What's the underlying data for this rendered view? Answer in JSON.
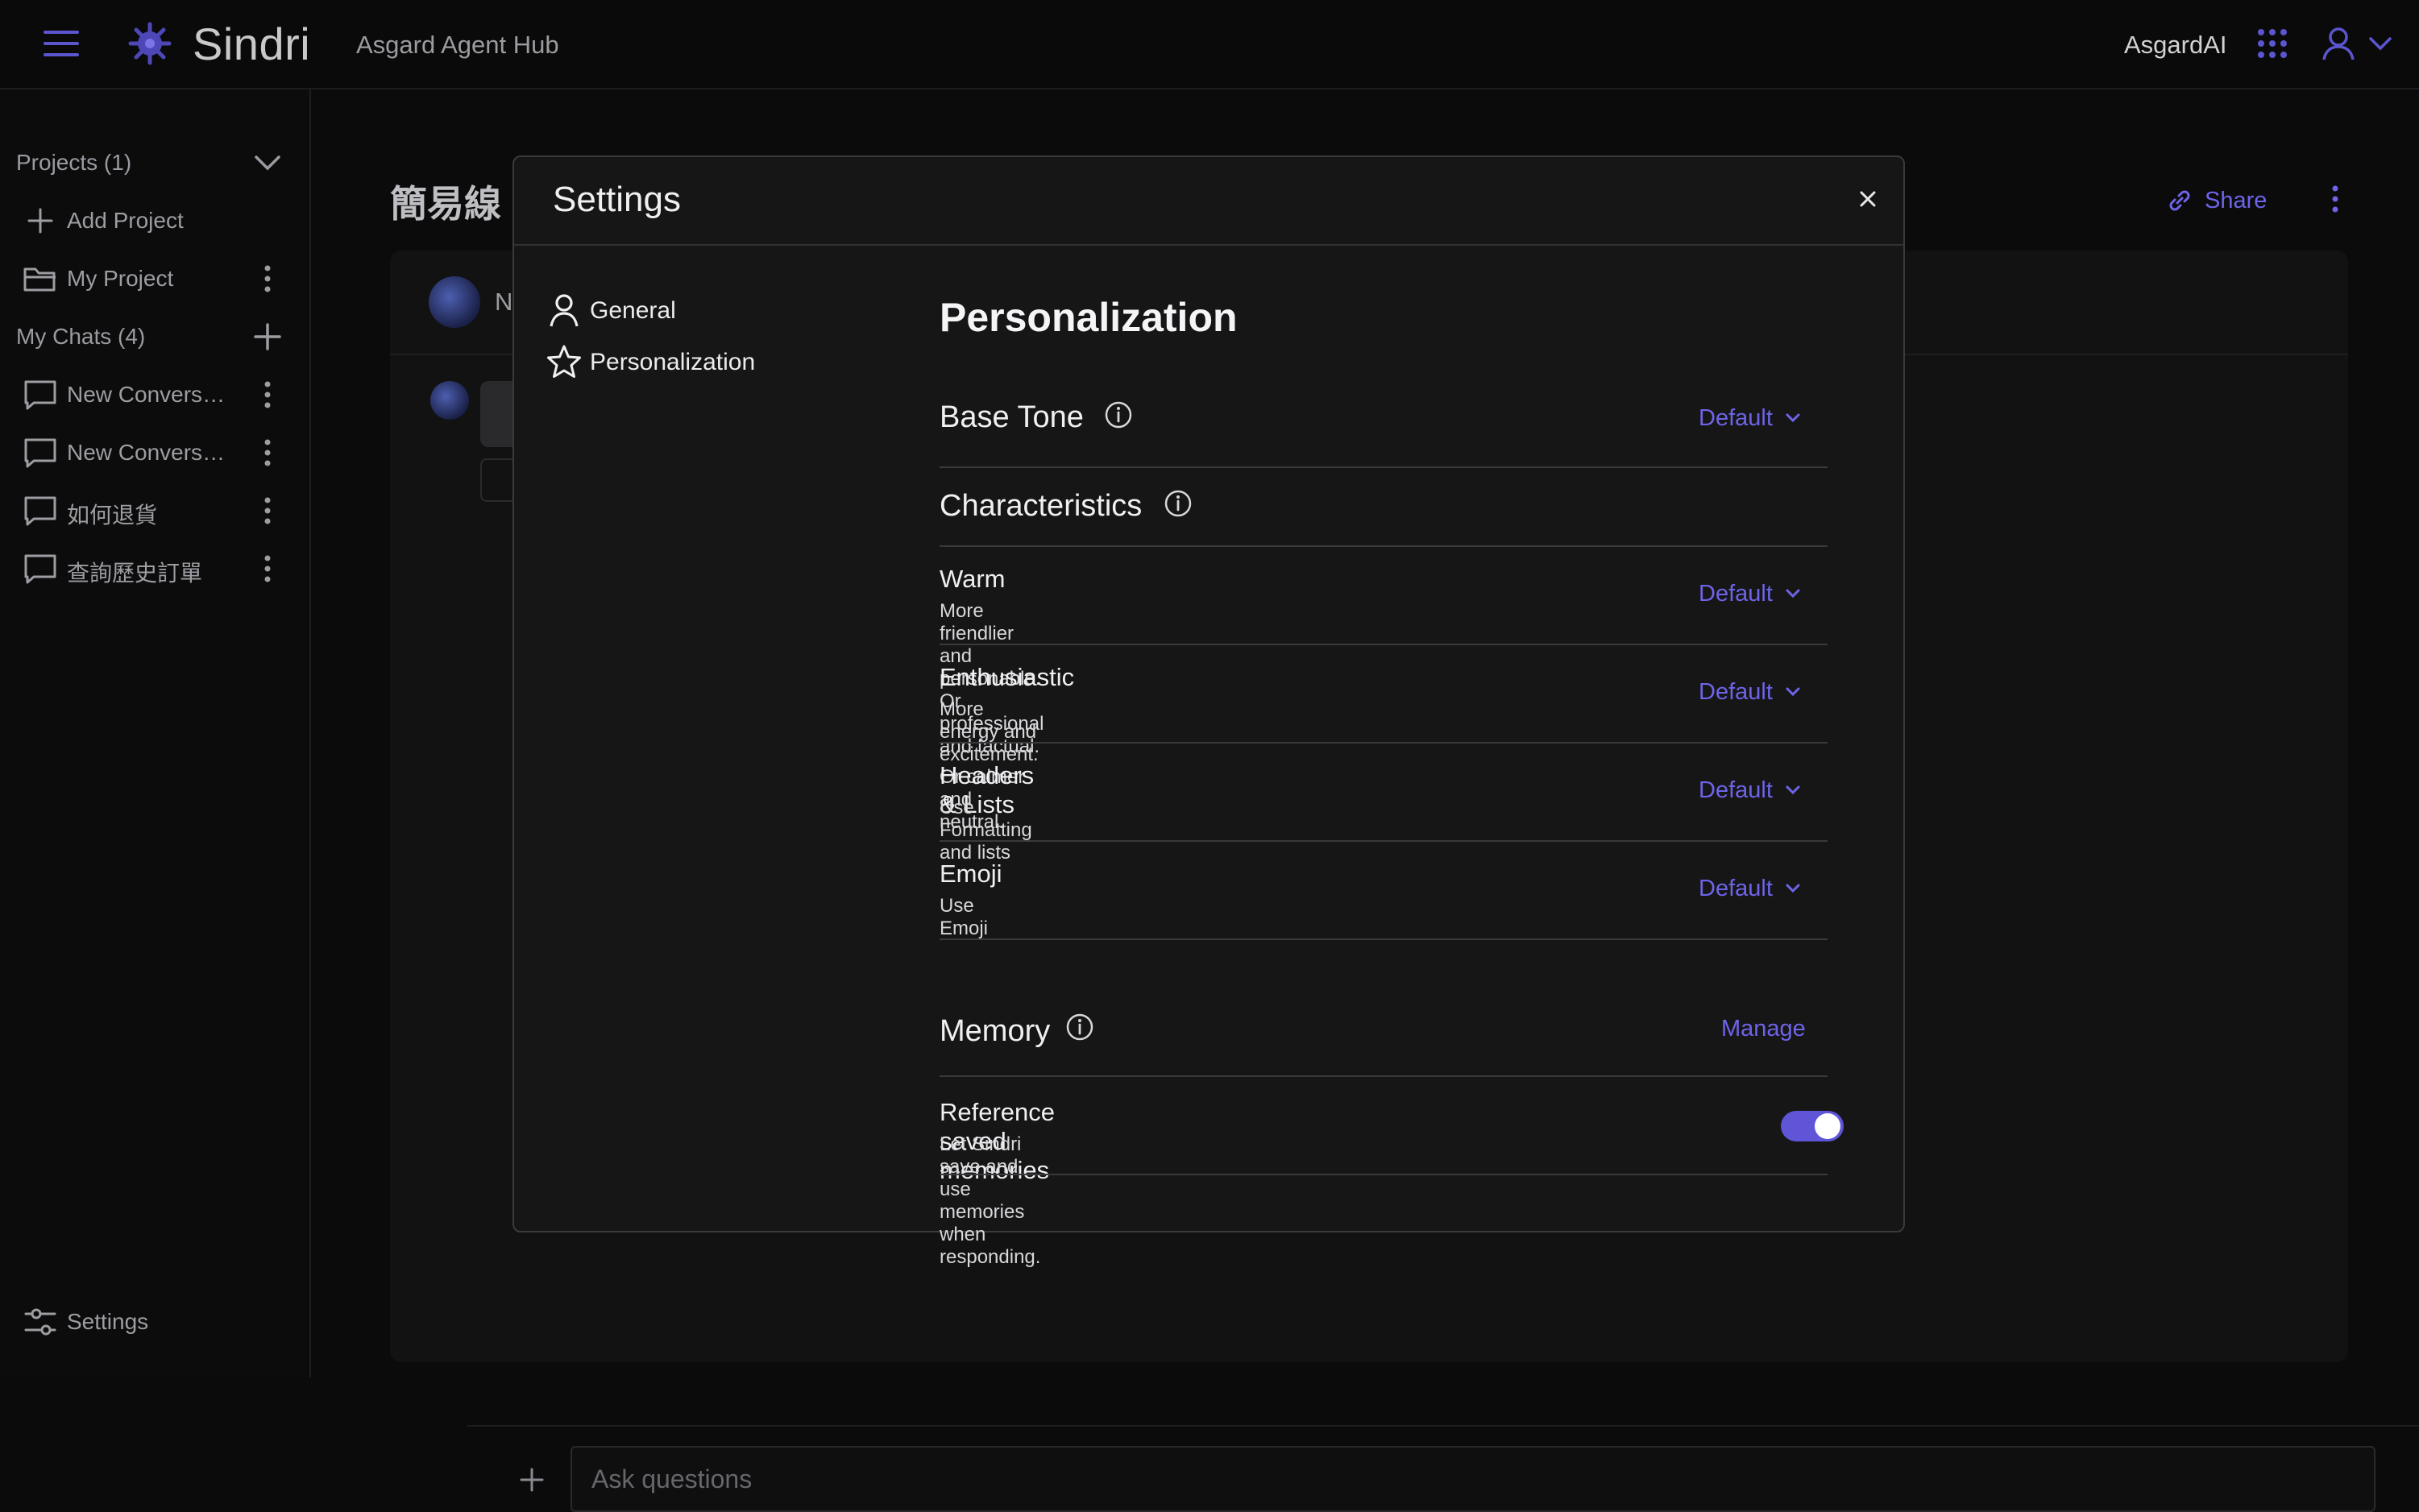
{
  "topbar": {
    "brand": "Sindri",
    "subtitle": "Asgard Agent Hub",
    "org": "AsgardAI",
    "icons": [
      "menu-icon",
      "sindri-logo-icon",
      "apps-grid-icon",
      "user-icon",
      "chevron-down-icon"
    ]
  },
  "sidebar": {
    "projects_heading": "Projects (1)",
    "add_project": "Add Project",
    "projects": [
      {
        "label": "My Project"
      }
    ],
    "chats_heading": "My Chats (4)",
    "chats": [
      {
        "label": "New Conversation"
      },
      {
        "label": "New Conversation"
      },
      {
        "label": "如何退貨"
      },
      {
        "label": "查詢歷史訂單"
      }
    ],
    "settings_label": "Settings"
  },
  "main": {
    "chat_title": "簡易線",
    "share_label": "Share",
    "agent_name_fragment": "N",
    "composer_placeholder": "Ask questions"
  },
  "modal": {
    "title": "Settings",
    "nav": [
      {
        "label": "General",
        "icon": "user-icon"
      },
      {
        "label": "Personalization",
        "icon": "star-icon"
      }
    ],
    "section_title": "Personalization",
    "base_tone": {
      "label": "Base Tone",
      "value": "Default"
    },
    "characteristics_label": "Characteristics",
    "characteristics": [
      {
        "title": "Warm",
        "desc": "More friendlier and personable. Or professional and factual.",
        "value": "Default"
      },
      {
        "title": "Enthusiastic",
        "desc": "More energy and excitement. Or calmer and neutral.",
        "value": "Default"
      },
      {
        "title": "Headers & Lists",
        "desc": "Use Formatting and lists",
        "value": "Default"
      },
      {
        "title": "Emoji",
        "desc": "Use Emoji",
        "value": "Default"
      }
    ],
    "memory": {
      "label": "Memory",
      "manage_label": "Manage",
      "reference_title": "Reference saved memories",
      "reference_desc": "Let Sindri save and use memories when responding.",
      "reference_enabled": true
    }
  },
  "colors": {
    "accent": "#6d64e8",
    "toggle_on": "#5f55d6",
    "background": "#0b0b0c",
    "modal_bg": "#161617"
  }
}
